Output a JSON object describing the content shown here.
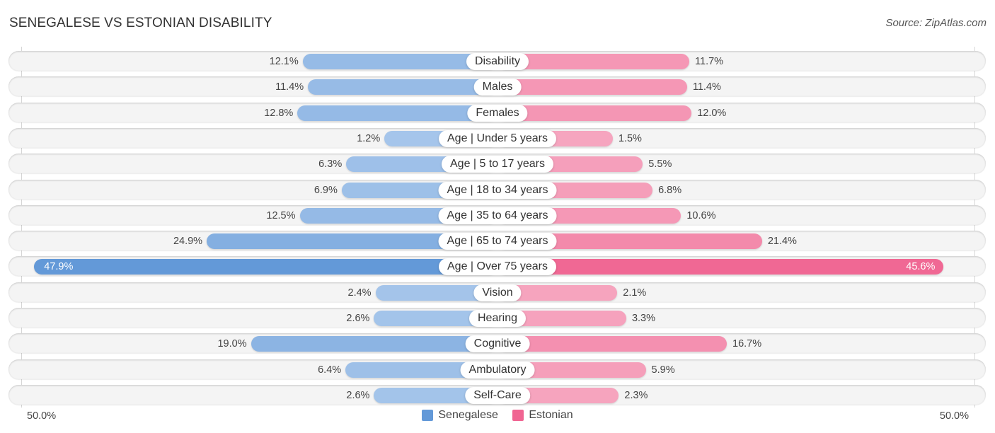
{
  "header": {
    "title": "SENEGALESE VS ESTONIAN DISABILITY",
    "source": "Source: ZipAtlas.com"
  },
  "colors": {
    "senegalese_strong": "#6399d8",
    "senegalese_light": "#a7c6eb",
    "estonian_strong": "#f06592",
    "estonian_light": "#f6a7c0"
  },
  "legend": {
    "items": [
      {
        "label": "Senegalese",
        "color": "#6399d8"
      },
      {
        "label": "Estonian",
        "color": "#f06592"
      }
    ]
  },
  "axis": {
    "left_label": "50.0%",
    "right_label": "50.0%"
  },
  "chart_data": {
    "type": "bar",
    "orientation": "horizontal-diverging",
    "title": "SENEGALESE VS ESTONIAN DISABILITY",
    "xlabel": "",
    "ylabel": "",
    "xlim": [
      0,
      50
    ],
    "unit": "%",
    "legend_position": "bottom-center",
    "categories": [
      "Disability",
      "Males",
      "Females",
      "Age | Under 5 years",
      "Age | 5 to 17 years",
      "Age | 18 to 34 years",
      "Age | 35 to 64 years",
      "Age | 65 to 74 years",
      "Age | Over 75 years",
      "Vision",
      "Hearing",
      "Cognitive",
      "Ambulatory",
      "Self-Care"
    ],
    "series": [
      {
        "name": "Senegalese",
        "side": "left",
        "values": [
          12.1,
          11.4,
          12.8,
          1.2,
          6.3,
          6.9,
          12.5,
          24.9,
          47.9,
          2.4,
          2.6,
          19.0,
          6.4,
          2.6
        ],
        "labels": [
          "12.1%",
          "11.4%",
          "12.8%",
          "1.2%",
          "6.3%",
          "6.9%",
          "12.5%",
          "24.9%",
          "47.9%",
          "2.4%",
          "2.6%",
          "19.0%",
          "6.4%",
          "2.6%"
        ]
      },
      {
        "name": "Estonian",
        "side": "right",
        "values": [
          11.7,
          11.4,
          12.0,
          1.5,
          5.5,
          6.8,
          10.6,
          21.4,
          45.6,
          2.1,
          3.3,
          16.7,
          5.9,
          2.3
        ],
        "labels": [
          "11.7%",
          "11.4%",
          "12.0%",
          "1.5%",
          "5.5%",
          "6.8%",
          "10.6%",
          "21.4%",
          "45.6%",
          "2.1%",
          "3.3%",
          "16.7%",
          "5.9%",
          "2.3%"
        ]
      }
    ]
  }
}
